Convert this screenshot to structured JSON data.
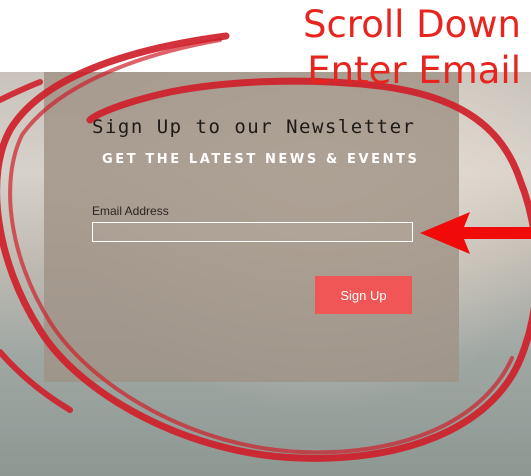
{
  "newsletter": {
    "title": "Sign Up to our Newsletter",
    "subtitle": "GET THE LATEST NEWS & EVENTS",
    "email_label": "Email Address",
    "email_value": "",
    "signup_label": "Sign Up"
  },
  "annotation": {
    "line1": "Scroll Down",
    "line2": "Enter Email",
    "color": "#e8241f"
  },
  "colors": {
    "button": "#f05656",
    "card": "#a09286",
    "circle_stroke": "#cf1f2a"
  }
}
